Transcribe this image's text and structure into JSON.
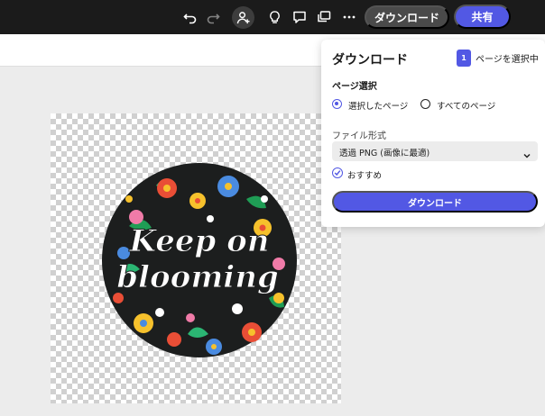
{
  "topbar": {
    "icons": [
      "undo-icon",
      "redo-icon",
      "add-person-icon",
      "lightbulb-icon",
      "comment-icon",
      "present-icon",
      "more-icon"
    ],
    "download_label": "ダウンロード",
    "share_label": "共有"
  },
  "canvas": {
    "design_text_line1": "Keep on",
    "design_text_line2": "blooming"
  },
  "download_panel": {
    "title": "ダウンロード",
    "page_count": "1",
    "page_count_label": "ページを選択中",
    "page_select_label": "ページ選択",
    "option_selected_page": "選択したページ",
    "option_all_pages": "すべてのページ",
    "format_label": "ファイル形式",
    "format_value": "透過 PNG (画像に最適)",
    "recommended_label": "おすすめ",
    "download_button": "ダウンロード"
  },
  "colors": {
    "accent": "#5258e4",
    "topbar_bg": "#1b1b1b",
    "design_bg": "#1c1e1e"
  }
}
